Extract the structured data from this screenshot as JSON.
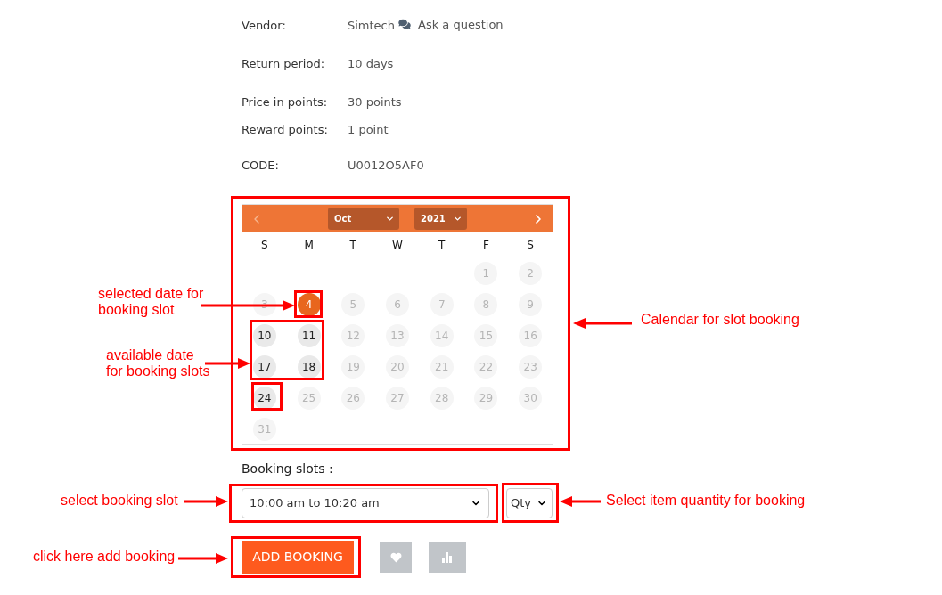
{
  "details": [
    {
      "label": "Vendor:",
      "value": "Simtech",
      "link": "Ask a question"
    },
    {
      "label": "Return period:",
      "value": "10 days"
    },
    {
      "label": "Price in points:",
      "value": "30 points"
    },
    {
      "label": "Reward points:",
      "value": "1 point"
    },
    {
      "label": "CODE:",
      "value": "U0012O5AF0"
    }
  ],
  "calendar": {
    "previous_disabled": true,
    "next_disabled": false,
    "month": "Oct",
    "year": "2021",
    "weekdays": [
      "S",
      "M",
      "T",
      "W",
      "T",
      "F",
      "S"
    ],
    "days": [
      {
        "label": "1",
        "available": false,
        "selected": false
      },
      {
        "label": "2",
        "available": false,
        "selected": false
      },
      {
        "label": "3",
        "available": false,
        "selected": false
      },
      {
        "label": "4",
        "available": true,
        "selected": true
      },
      {
        "label": "5",
        "available": false,
        "selected": false
      },
      {
        "label": "6",
        "available": false,
        "selected": false
      },
      {
        "label": "7",
        "available": false,
        "selected": false
      },
      {
        "label": "8",
        "available": false,
        "selected": false
      },
      {
        "label": "9",
        "available": false,
        "selected": false
      },
      {
        "label": "10",
        "available": true,
        "selected": false
      },
      {
        "label": "11",
        "available": true,
        "selected": false
      },
      {
        "label": "12",
        "available": false,
        "selected": false
      },
      {
        "label": "13",
        "available": false,
        "selected": false
      },
      {
        "label": "14",
        "available": false,
        "selected": false
      },
      {
        "label": "15",
        "available": false,
        "selected": false
      },
      {
        "label": "16",
        "available": false,
        "selected": false
      },
      {
        "label": "17",
        "available": true,
        "selected": false
      },
      {
        "label": "18",
        "available": true,
        "selected": false
      },
      {
        "label": "19",
        "available": false,
        "selected": false
      },
      {
        "label": "20",
        "available": false,
        "selected": false
      },
      {
        "label": "21",
        "available": false,
        "selected": false
      },
      {
        "label": "22",
        "available": false,
        "selected": false
      },
      {
        "label": "23",
        "available": false,
        "selected": false
      },
      {
        "label": "24",
        "available": true,
        "selected": false
      },
      {
        "label": "25",
        "available": false,
        "selected": false
      },
      {
        "label": "26",
        "available": false,
        "selected": false
      },
      {
        "label": "27",
        "available": false,
        "selected": false
      },
      {
        "label": "28",
        "available": false,
        "selected": false
      },
      {
        "label": "29",
        "available": false,
        "selected": false
      },
      {
        "label": "30",
        "available": false,
        "selected": false
      },
      {
        "label": "31",
        "available": false,
        "selected": false
      }
    ]
  },
  "booking": {
    "label": "Booking slots :",
    "slot": "10:00 am to 10:20 am",
    "quantity": "Qty",
    "add_button": "ADD BOOKING"
  },
  "annotations": [
    "selected date for booking slot",
    "Calendar for slot booking",
    "available date for booking slots",
    "select booking slot",
    "Select item quantity for booking",
    "click here add booking"
  ]
}
